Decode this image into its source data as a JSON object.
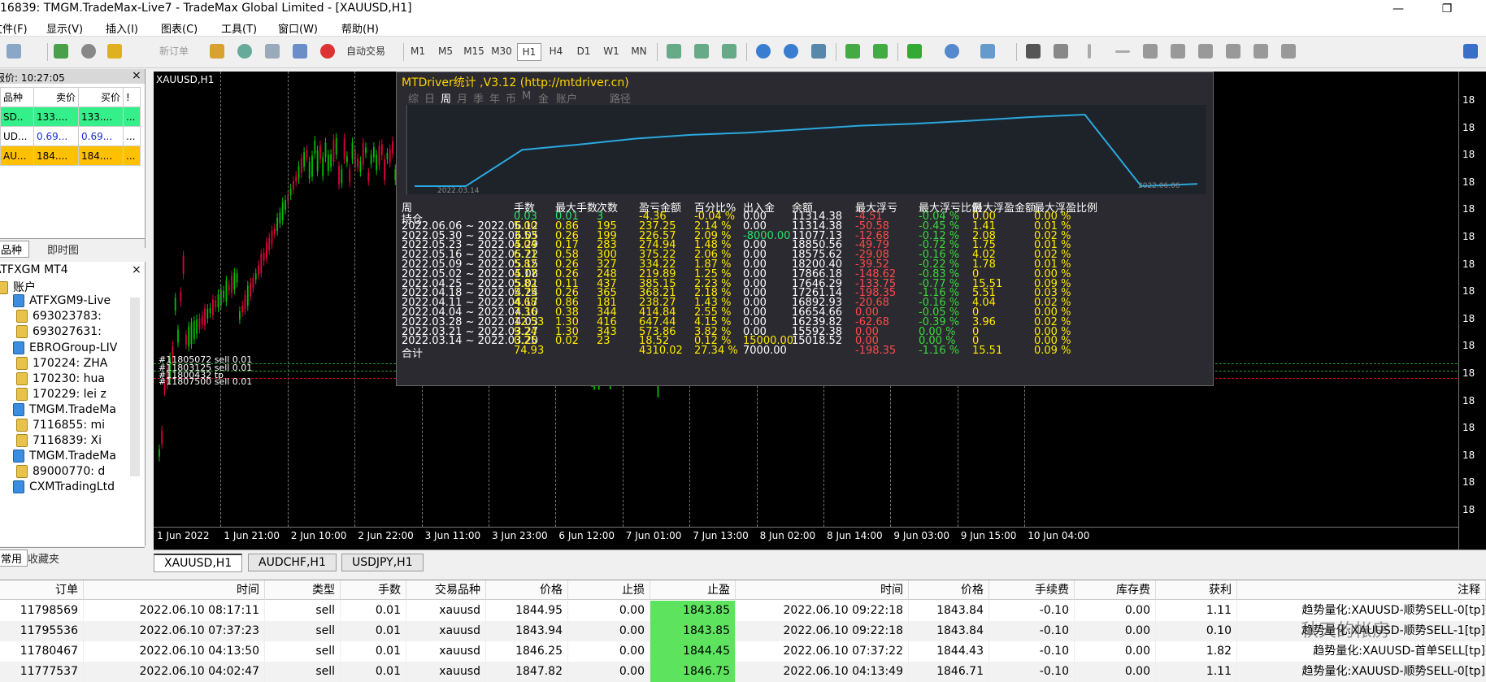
{
  "window": {
    "title": "16839: TMGM.TradeMax-Live7 - TradeMax Global Limited - [XAUUSD,H1]",
    "btn_min": "—",
    "btn_restore": "❐"
  },
  "menu": [
    "文件(F)",
    "显示(V)",
    "插入(I)",
    "图表(C)",
    "工具(T)",
    "窗口(W)",
    "帮助(H)"
  ],
  "toolbar": {
    "new_order": "新订单",
    "auto_trade": "自动交易",
    "timeframes": [
      "M1",
      "M5",
      "M15",
      "M30",
      "H1",
      "H4",
      "D1",
      "W1",
      "MN"
    ],
    "active_tf": "H1"
  },
  "market_watch": {
    "header": "报价: 10:27:05",
    "close": "×",
    "columns": [
      "品种",
      "卖价",
      "买价",
      "!"
    ],
    "rows": [
      {
        "symbol": "SD..",
        "bid": "133....",
        "ask": "133....",
        "flag": "..."
      },
      {
        "symbol": "UD...",
        "bid": "0.69...",
        "ask": "0.69...",
        "flag": "..."
      },
      {
        "symbol": "AU...",
        "bid": "184....",
        "ask": "184....",
        "flag": "..."
      }
    ],
    "tabs": [
      "品种",
      "即时图"
    ]
  },
  "navigator": {
    "close": "×",
    "items": [
      {
        "text": "ATFXGM MT4",
        "type": "root"
      },
      {
        "text": "账户",
        "type": "acc"
      },
      {
        "text": "ATFXGM9-Live",
        "type": "srv"
      },
      {
        "text": "693023783:",
        "type": "acc"
      },
      {
        "text": "693027631:",
        "type": "acc"
      },
      {
        "text": "EBROGroup-LIV",
        "type": "srv"
      },
      {
        "text": "170224: ZHA",
        "type": "acc"
      },
      {
        "text": "170230: hua",
        "type": "acc"
      },
      {
        "text": "170229: lei z",
        "type": "acc"
      },
      {
        "text": "TMGM.TradeMa",
        "type": "srv"
      },
      {
        "text": "7116855: mi",
        "type": "acc"
      },
      {
        "text": "7116839: Xi",
        "type": "acc"
      },
      {
        "text": "TMGM.TradeMa",
        "type": "srv"
      },
      {
        "text": "89000770: d",
        "type": "acc"
      },
      {
        "text": "CXMTradingLtd",
        "type": "srv"
      }
    ],
    "tabs": [
      "常用",
      "收藏夹"
    ]
  },
  "chart": {
    "symbol_label": "XAUUSD,H1",
    "time_labels": [
      "1 Jun 2022",
      "1 Jun 21:00",
      "2 Jun 10:00",
      "2 Jun 22:00",
      "3 Jun 11:00",
      "3 Jun 23:00",
      "6 Jun 12:00",
      "7 Jun 01:00",
      "7 Jun 13:00",
      "8 Jun 02:00",
      "8 Jun 14:00",
      "9 Jun 03:00",
      "9 Jun 15:00",
      "10 Jun 04:00"
    ],
    "price_labels": [
      "18",
      "18",
      "18",
      "18",
      "18",
      "18",
      "18",
      "18",
      "18",
      "18",
      "18",
      "18",
      "18",
      "18",
      "18",
      "18"
    ],
    "order_labels": [
      "#11805072 sell 0.01",
      "#11803125 sell 0.01",
      "#11800432 tp",
      "#11807500 sell 0.01"
    ],
    "colors": {
      "up": "#00c000",
      "down": "#e0003c",
      "bg": "#000000",
      "grid": "#777777"
    }
  },
  "stats": {
    "title": "MTDriver统计 ,V3.12 (http://mtdriver.cn)",
    "tabs": [
      "综",
      "日",
      "周",
      "月",
      "季",
      "年",
      "币",
      "M",
      "金",
      "账户",
      "路径"
    ],
    "active_tab": "周",
    "graph_start": "2022.03.14",
    "graph_end": "2022.06.06",
    "columns": [
      "周",
      "手数",
      "最大手数",
      "次数",
      "盈亏金额",
      "百分比%",
      "出入金",
      "余额",
      "最大浮亏",
      "最大浮亏比例",
      "最大浮盈金额",
      "最大浮盈比例"
    ],
    "rows": [
      [
        "持仓",
        "0.03",
        "0.01",
        "3",
        "-4.36",
        "-0.04 %",
        "0.00",
        "11314.38",
        "-4.51",
        "-0.04 %",
        "0.00",
        "0.00 %"
      ],
      [
        "2022.06.06 ~ 2022.06.12",
        "5.00",
        "0.86",
        "195",
        "237.25",
        "2.14 %",
        "0.00",
        "11314.38",
        "-50.58",
        "-0.45 %",
        "1.41",
        "0.01 %"
      ],
      [
        "2022.05.30 ~ 2022.06.05",
        "3.53",
        "0.26",
        "199",
        "226.57",
        "2.09 %",
        "-8000.00",
        "11077.13",
        "-12.68",
        "-0.12 %",
        "2.08",
        "0.02 %"
      ],
      [
        "2022.05.23 ~ 2022.05.29",
        "4.04",
        "0.17",
        "283",
        "274.94",
        "1.48 %",
        "0.00",
        "18850.56",
        "-49.79",
        "-0.72 %",
        "1.75",
        "0.01 %"
      ],
      [
        "2022.05.16 ~ 2022.05.22",
        "6.71",
        "0.58",
        "300",
        "375.22",
        "2.06 %",
        "0.00",
        "18575.62",
        "-29.08",
        "-0.16 %",
        "4.02",
        "0.02 %"
      ],
      [
        "2022.05.09 ~ 2022.05.15",
        "5.82",
        "0.26",
        "327",
        "334.22",
        "1.87 %",
        "0.00",
        "18200.40",
        "-39.52",
        "-0.22 %",
        "1.78",
        "0.01 %"
      ],
      [
        "2022.05.02 ~ 2022.05.08",
        "4.17",
        "0.26",
        "248",
        "219.89",
        "1.25 %",
        "0.00",
        "17866.18",
        "-148.62",
        "-0.83 %",
        "0",
        "0.00 %"
      ],
      [
        "2022.04.25 ~ 2022.05.01",
        "5.82",
        "0.11",
        "437",
        "385.15",
        "2.23 %",
        "0.00",
        "17646.29",
        "-133.75",
        "-0.77 %",
        "15.51",
        "0.09 %"
      ],
      [
        "2022.04.18 ~ 2022.04.24",
        "5.75",
        "0.26",
        "365",
        "368.21",
        "2.18 %",
        "0.00",
        "17261.14",
        "-198.35",
        "-1.16 %",
        "5.51",
        "0.03 %"
      ],
      [
        "2022.04.11 ~ 2022.04.17",
        "4.68",
        "0.86",
        "181",
        "238.27",
        "1.43 %",
        "0.00",
        "16892.93",
        "-20.68",
        "-0.16 %",
        "4.04",
        "0.02 %"
      ],
      [
        "2022.04.04 ~ 2022.04.10",
        "7.36",
        "0.38",
        "344",
        "414.84",
        "2.55 %",
        "0.00",
        "16654.66",
        "0.00",
        "-0.05 %",
        "0",
        "0.00 %"
      ],
      [
        "2022.03.28 ~ 2022.04.03",
        "12.53",
        "1.30",
        "416",
        "647.44",
        "4.15 %",
        "0.00",
        "16239.82",
        "-62.68",
        "-0.39 %",
        "3.96",
        "0.02 %"
      ],
      [
        "2022.03.21 ~ 2022.03.27",
        "9.24",
        "1.30",
        "343",
        "573.86",
        "3.82 %",
        "0.00",
        "15592.38",
        "0.00",
        "0.00 %",
        "0",
        "0.00 %"
      ],
      [
        "2022.03.14 ~ 2022.03.20",
        "0.25",
        "0.02",
        "23",
        "18.52",
        "0.12 %",
        "15000.00",
        "15018.52",
        "0.00",
        "0.00 %",
        "0",
        "0.00 %"
      ],
      [
        "合计",
        "74.93",
        "",
        "",
        "4310.02",
        "27.34 %",
        "7000.00",
        "",
        "-198.35",
        "-1.16 %",
        "15.51",
        "0.09 %"
      ]
    ]
  },
  "chart_tabs": [
    "XAUUSD,H1",
    "AUDCHF,H1",
    "USDJPY,H1"
  ],
  "terminal": {
    "columns": [
      "订单",
      "时间",
      "类型",
      "手数",
      "交易品种",
      "价格",
      "止损",
      "止盈",
      "时间",
      "价格",
      "手续费",
      "库存费",
      "获利",
      "注释"
    ],
    "rows": [
      [
        "11798569",
        "2022.06.10 08:17:11",
        "sell",
        "0.01",
        "xauusd",
        "1844.95",
        "0.00",
        "1843.85",
        "2022.06.10 09:22:18",
        "1843.84",
        "-0.10",
        "0.00",
        "1.11",
        "趋势量化:XAUUSD-顺势SELL-0[tp]"
      ],
      [
        "11795536",
        "2022.06.10 07:37:23",
        "sell",
        "0.01",
        "xauusd",
        "1843.94",
        "0.00",
        "1843.85",
        "2022.06.10 09:22:18",
        "1843.84",
        "-0.10",
        "0.00",
        "0.10",
        "趋势量化:XAUUSD-顺势SELL-1[tp]"
      ],
      [
        "11780467",
        "2022.06.10 04:13:50",
        "sell",
        "0.01",
        "xauusd",
        "1846.25",
        "0.00",
        "1844.45",
        "2022.06.10 07:37:22",
        "1844.43",
        "-0.10",
        "0.00",
        "1.82",
        "趋势量化:XAUUSD-首单SELL[tp]"
      ],
      [
        "11777537",
        "2022.06.10 04:02:47",
        "sell",
        "0.01",
        "xauusd",
        "1847.82",
        "0.00",
        "1846.75",
        "2022.06.10 04:13:49",
        "1846.71",
        "-0.10",
        "0.00",
        "1.11",
        "趋势量化:XAUUSD-顺势SELL-0[tp]"
      ]
    ],
    "watermark": "秋天的帐房"
  }
}
